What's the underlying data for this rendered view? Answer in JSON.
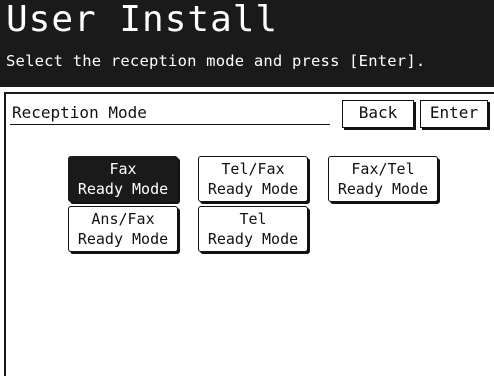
{
  "header": {
    "title": "User Install",
    "subtitle": "Select the reception mode and press [Enter]."
  },
  "panel": {
    "label": "Reception Mode",
    "back_label": "Back",
    "enter_label": "Enter"
  },
  "modes": [
    {
      "line1": "Fax",
      "line2": "Ready Mode",
      "selected": true
    },
    {
      "line1": "Tel/Fax",
      "line2": "Ready Mode",
      "selected": false
    },
    {
      "line1": "Fax/Tel",
      "line2": "Ready Mode",
      "selected": false
    },
    {
      "line1": "Ans/Fax",
      "line2": "Ready Mode",
      "selected": false
    },
    {
      "line1": "Tel",
      "line2": "Ready Mode",
      "selected": false
    }
  ],
  "colors": {
    "header_bg": "#1a1a1a",
    "selected_bg": "#1a1a1a",
    "text": "#111111",
    "background": "#ffffff"
  }
}
